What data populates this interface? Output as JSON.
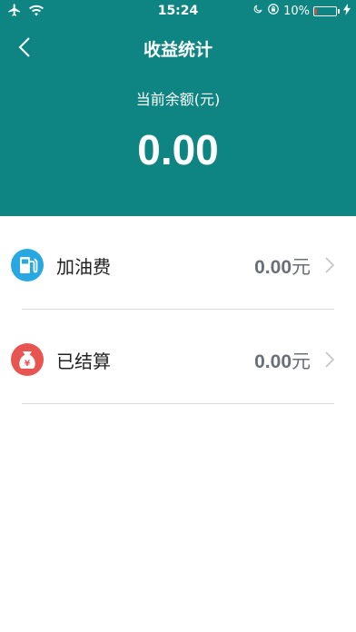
{
  "status_bar": {
    "time": "15:24",
    "battery_percent_label": "10%",
    "battery_level": 0.1,
    "icons": [
      "airplane-icon",
      "wifi-icon",
      "moon-icon",
      "rotation-lock-icon",
      "battery-icon",
      "charging-icon"
    ]
  },
  "nav": {
    "title": "收益统计",
    "back_icon": "chevron-left-icon"
  },
  "balance": {
    "label": "当前余额(元)",
    "value": "0.00"
  },
  "rows": [
    {
      "label": "加油费",
      "amount": "0.00",
      "unit": "元",
      "icon": "fuel-pump-icon",
      "icon_color": "#27a8e0"
    },
    {
      "label": "已结算",
      "amount": "0.00",
      "unit": "元",
      "icon": "money-bag-icon",
      "icon_color": "#e85550"
    }
  ],
  "colors": {
    "header_bg": "#0e8582",
    "text_secondary": "#6a6e77"
  }
}
